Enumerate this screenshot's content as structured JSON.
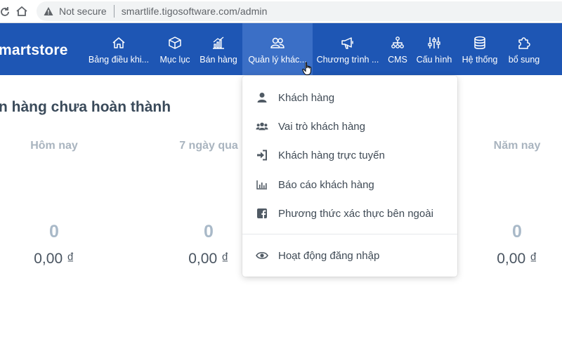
{
  "browser": {
    "security_label": "Not secure",
    "url": "smartlife.tigosoftware.com/admin"
  },
  "app": {
    "brand": "martstore"
  },
  "nav": {
    "items": [
      {
        "label": "Bảng điều khi...",
        "icon": "home-icon"
      },
      {
        "label": "Mục lục",
        "icon": "cube-icon"
      },
      {
        "label": "Bán hàng",
        "icon": "chart-bars-icon"
      },
      {
        "label": "Quản lý khác...",
        "icon": "users-icon",
        "active": true
      },
      {
        "label": "Chương trình ...",
        "icon": "megaphone-icon"
      },
      {
        "label": "CMS",
        "icon": "sitemap-icon"
      },
      {
        "label": "Cấu hình",
        "icon": "sliders-icon"
      },
      {
        "label": "Hệ thống",
        "icon": "database-icon"
      },
      {
        "label": "bổ sung",
        "icon": "puzzle-icon"
      }
    ]
  },
  "page": {
    "section_title": "n hàng chưa hoàn thành",
    "stats": [
      {
        "label": "Hôm nay",
        "count": "0",
        "amount": "0,00 ₫"
      },
      {
        "label": "7 ngày qua",
        "count": "0",
        "amount": "0,00 ₫"
      },
      {
        "label": "Năm nay",
        "count": "0",
        "amount": "0,00 ₫"
      }
    ]
  },
  "dropdown": {
    "items": [
      {
        "label": "Khách hàng",
        "icon": "user-icon"
      },
      {
        "label": "Vai trò khách hàng",
        "icon": "users-group-icon"
      },
      {
        "label": "Khách hàng trực tuyến",
        "icon": "sign-in-icon"
      },
      {
        "label": "Báo cáo khách hàng",
        "icon": "bar-chart-icon"
      },
      {
        "label": "Phương thức xác thực bên ngoài",
        "icon": "facebook-icon"
      }
    ],
    "footer_items": [
      {
        "label": "Hoạt động đăng nhập",
        "icon": "eye-icon"
      }
    ]
  },
  "colors": {
    "navbar": "#1e56b4",
    "nav_active": "#3b6fc6",
    "muted_text": "#a9b4bf"
  }
}
